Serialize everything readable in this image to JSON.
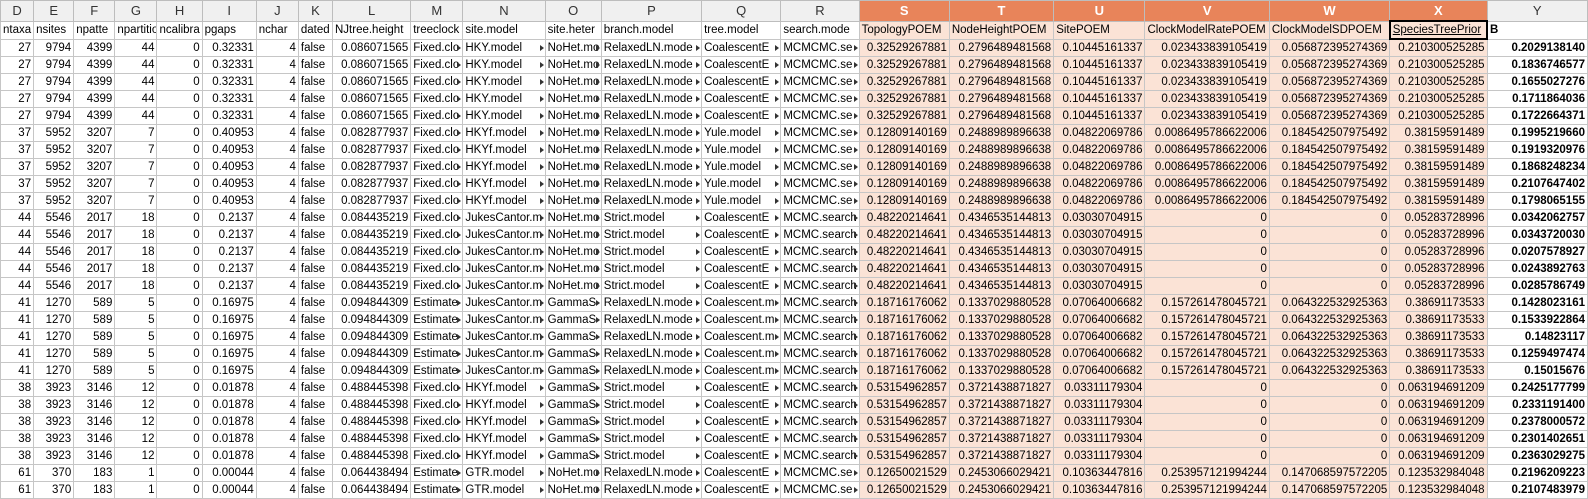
{
  "column_letters": [
    "D",
    "E",
    "F",
    "G",
    "H",
    "I",
    "J",
    "K",
    "L",
    "M",
    "N",
    "O",
    "P",
    "Q",
    "R",
    "S",
    "T",
    "U",
    "V",
    "W",
    "X",
    "Y"
  ],
  "selected_columns": [
    "S",
    "T",
    "U",
    "V",
    "W",
    "X"
  ],
  "header_row": [
    "ntaxa",
    "nsites",
    "npatte",
    "npartitio",
    "ncalibra",
    "pgaps",
    "nchar",
    "dated",
    "NJtree.height",
    "treeclock",
    "site.model",
    "site.heter",
    "branch.model",
    "tree.model",
    "search.mode",
    "TopologyPOEM",
    "NodeHeightPOEM",
    "SitePOEM",
    "ClockModelRatePOEM",
    "ClockModelSDPOEM",
    "SpeciesTreePrior",
    "B"
  ],
  "rows": [
    [
      "27",
      "9794",
      "4399",
      "44",
      "0",
      "0.32331",
      "4",
      "false",
      "0.086071565",
      "Fixed.clo",
      "HKY.model",
      "NoHet.mo",
      "RelaxedLN.mode",
      "CoalescentE",
      "MCMCMC.se",
      "0.32529267881",
      "0.2796489481568",
      "0.10445161337",
      "0.023433839105419",
      "0.056872395274369",
      "0.210300525285",
      "0.2029138140"
    ],
    [
      "27",
      "9794",
      "4399",
      "44",
      "0",
      "0.32331",
      "4",
      "false",
      "0.086071565",
      "Fixed.clo",
      "HKY.model",
      "NoHet.mo",
      "RelaxedLN.mode",
      "CoalescentE",
      "MCMCMC.se",
      "0.32529267881",
      "0.2796489481568",
      "0.10445161337",
      "0.023433839105419",
      "0.056872395274369",
      "0.210300525285",
      "0.1836746577"
    ],
    [
      "27",
      "9794",
      "4399",
      "44",
      "0",
      "0.32331",
      "4",
      "false",
      "0.086071565",
      "Fixed.clo",
      "HKY.model",
      "NoHet.mo",
      "RelaxedLN.mode",
      "CoalescentE",
      "MCMCMC.se",
      "0.32529267881",
      "0.2796489481568",
      "0.10445161337",
      "0.023433839105419",
      "0.056872395274369",
      "0.210300525285",
      "0.1655027276"
    ],
    [
      "27",
      "9794",
      "4399",
      "44",
      "0",
      "0.32331",
      "4",
      "false",
      "0.086071565",
      "Fixed.clo",
      "HKY.model",
      "NoHet.mo",
      "RelaxedLN.mode",
      "CoalescentE",
      "MCMCMC.se",
      "0.32529267881",
      "0.2796489481568",
      "0.10445161337",
      "0.023433839105419",
      "0.056872395274369",
      "0.210300525285",
      "0.1711864036"
    ],
    [
      "27",
      "9794",
      "4399",
      "44",
      "0",
      "0.32331",
      "4",
      "false",
      "0.086071565",
      "Fixed.clo",
      "HKY.model",
      "NoHet.mo",
      "RelaxedLN.mode",
      "CoalescentE",
      "MCMCMC.se",
      "0.32529267881",
      "0.2796489481568",
      "0.10445161337",
      "0.023433839105419",
      "0.056872395274369",
      "0.210300525285",
      "0.1722664371"
    ],
    [
      "37",
      "5952",
      "3207",
      "7",
      "0",
      "0.40953",
      "4",
      "false",
      "0.082877937",
      "Fixed.clo",
      "HKYf.model",
      "NoHet.mo",
      "RelaxedLN.mode",
      "Yule.model",
      "MCMCMC.se",
      "0.12809140169",
      "0.2488989896638",
      "0.04822069786",
      "0.0086495786622006",
      "0.184542507975492",
      "0.38159591489",
      "0.1995219660"
    ],
    [
      "37",
      "5952",
      "3207",
      "7",
      "0",
      "0.40953",
      "4",
      "false",
      "0.082877937",
      "Fixed.clo",
      "HKYf.model",
      "NoHet.mo",
      "RelaxedLN.mode",
      "Yule.model",
      "MCMCMC.se",
      "0.12809140169",
      "0.2488989896638",
      "0.04822069786",
      "0.0086495786622006",
      "0.184542507975492",
      "0.38159591489",
      "0.1919320976"
    ],
    [
      "37",
      "5952",
      "3207",
      "7",
      "0",
      "0.40953",
      "4",
      "false",
      "0.082877937",
      "Fixed.clo",
      "HKYf.model",
      "NoHet.mo",
      "RelaxedLN.mode",
      "Yule.model",
      "MCMCMC.se",
      "0.12809140169",
      "0.2488989896638",
      "0.04822069786",
      "0.0086495786622006",
      "0.184542507975492",
      "0.38159591489",
      "0.1868248234"
    ],
    [
      "37",
      "5952",
      "3207",
      "7",
      "0",
      "0.40953",
      "4",
      "false",
      "0.082877937",
      "Fixed.clo",
      "HKYf.model",
      "NoHet.mo",
      "RelaxedLN.mode",
      "Yule.model",
      "MCMCMC.se",
      "0.12809140169",
      "0.2488989896638",
      "0.04822069786",
      "0.0086495786622006",
      "0.184542507975492",
      "0.38159591489",
      "0.2107647402"
    ],
    [
      "37",
      "5952",
      "3207",
      "7",
      "0",
      "0.40953",
      "4",
      "false",
      "0.082877937",
      "Fixed.clo",
      "HKYf.model",
      "NoHet.mo",
      "RelaxedLN.mode",
      "Yule.model",
      "MCMCMC.se",
      "0.12809140169",
      "0.2488989896638",
      "0.04822069786",
      "0.0086495786622006",
      "0.184542507975492",
      "0.38159591489",
      "0.1798065155"
    ],
    [
      "44",
      "5546",
      "2017",
      "18",
      "0",
      "0.2137",
      "4",
      "false",
      "0.084435219",
      "Fixed.clo",
      "JukesCantor.m",
      "NoHet.mo",
      "Strict.model",
      "CoalescentE",
      "MCMC.search",
      "0.48220214641",
      "0.4346535144813",
      "0.03030704915",
      "0",
      "0",
      "0.05283728996",
      "0.0342062757"
    ],
    [
      "44",
      "5546",
      "2017",
      "18",
      "0",
      "0.2137",
      "4",
      "false",
      "0.084435219",
      "Fixed.clo",
      "JukesCantor.m",
      "NoHet.mo",
      "Strict.model",
      "CoalescentE",
      "MCMC.search",
      "0.48220214641",
      "0.4346535144813",
      "0.03030704915",
      "0",
      "0",
      "0.05283728996",
      "0.0343720030"
    ],
    [
      "44",
      "5546",
      "2017",
      "18",
      "0",
      "0.2137",
      "4",
      "false",
      "0.084435219",
      "Fixed.clo",
      "JukesCantor.m",
      "NoHet.mo",
      "Strict.model",
      "CoalescentE",
      "MCMC.search",
      "0.48220214641",
      "0.4346535144813",
      "0.03030704915",
      "0",
      "0",
      "0.05283728996",
      "0.0207578927"
    ],
    [
      "44",
      "5546",
      "2017",
      "18",
      "0",
      "0.2137",
      "4",
      "false",
      "0.084435219",
      "Fixed.clo",
      "JukesCantor.m",
      "NoHet.mo",
      "Strict.model",
      "CoalescentE",
      "MCMC.search",
      "0.48220214641",
      "0.4346535144813",
      "0.03030704915",
      "0",
      "0",
      "0.05283728996",
      "0.0243892763"
    ],
    [
      "44",
      "5546",
      "2017",
      "18",
      "0",
      "0.2137",
      "4",
      "false",
      "0.084435219",
      "Fixed.clo",
      "JukesCantor.m",
      "NoHet.mo",
      "Strict.model",
      "CoalescentE",
      "MCMC.search",
      "0.48220214641",
      "0.4346535144813",
      "0.03030704915",
      "0",
      "0",
      "0.05283728996",
      "0.0285786749"
    ],
    [
      "41",
      "1270",
      "589",
      "5",
      "0",
      "0.16975",
      "4",
      "false",
      "0.094844309",
      "Estimate",
      "JukesCantor.m",
      "GammaS",
      "RelaxedLN.mode",
      "Coalescent.m",
      "MCMC.search",
      "0.18716176062",
      "0.1337029880528",
      "0.07064006682",
      "0.157261478045721",
      "0.064322532925363",
      "0.38691173533",
      "0.1428023161"
    ],
    [
      "41",
      "1270",
      "589",
      "5",
      "0",
      "0.16975",
      "4",
      "false",
      "0.094844309",
      "Estimate",
      "JukesCantor.m",
      "GammaS",
      "RelaxedLN.mode",
      "Coalescent.m",
      "MCMC.search",
      "0.18716176062",
      "0.1337029880528",
      "0.07064006682",
      "0.157261478045721",
      "0.064322532925363",
      "0.38691173533",
      "0.1533922864"
    ],
    [
      "41",
      "1270",
      "589",
      "5",
      "0",
      "0.16975",
      "4",
      "false",
      "0.094844309",
      "Estimate",
      "JukesCantor.m",
      "GammaS",
      "RelaxedLN.mode",
      "Coalescent.m",
      "MCMC.search",
      "0.18716176062",
      "0.1337029880528",
      "0.07064006682",
      "0.157261478045721",
      "0.064322532925363",
      "0.38691173533",
      "0.14823117"
    ],
    [
      "41",
      "1270",
      "589",
      "5",
      "0",
      "0.16975",
      "4",
      "false",
      "0.094844309",
      "Estimate",
      "JukesCantor.m",
      "GammaS",
      "RelaxedLN.mode",
      "Coalescent.m",
      "MCMC.search",
      "0.18716176062",
      "0.1337029880528",
      "0.07064006682",
      "0.157261478045721",
      "0.064322532925363",
      "0.38691173533",
      "0.1259497474"
    ],
    [
      "41",
      "1270",
      "589",
      "5",
      "0",
      "0.16975",
      "4",
      "false",
      "0.094844309",
      "Estimate",
      "JukesCantor.m",
      "GammaS",
      "RelaxedLN.mode",
      "Coalescent.m",
      "MCMC.search",
      "0.18716176062",
      "0.1337029880528",
      "0.07064006682",
      "0.157261478045721",
      "0.064322532925363",
      "0.38691173533",
      "0.15015676"
    ],
    [
      "38",
      "3923",
      "3146",
      "12",
      "0",
      "0.01878",
      "4",
      "false",
      "0.488445398",
      "Fixed.clo",
      "HKYf.model",
      "GammaS",
      "Strict.model",
      "CoalescentE",
      "MCMC.search",
      "0.53154962857",
      "0.3721438871827",
      "0.03311179304",
      "0",
      "0",
      "0.063194691209",
      "0.2425177799"
    ],
    [
      "38",
      "3923",
      "3146",
      "12",
      "0",
      "0.01878",
      "4",
      "false",
      "0.488445398",
      "Fixed.clo",
      "HKYf.model",
      "GammaS",
      "Strict.model",
      "CoalescentE",
      "MCMC.search",
      "0.53154962857",
      "0.3721438871827",
      "0.03311179304",
      "0",
      "0",
      "0.063194691209",
      "0.2331191400"
    ],
    [
      "38",
      "3923",
      "3146",
      "12",
      "0",
      "0.01878",
      "4",
      "false",
      "0.488445398",
      "Fixed.clo",
      "HKYf.model",
      "GammaS",
      "Strict.model",
      "CoalescentE",
      "MCMC.search",
      "0.53154962857",
      "0.3721438871827",
      "0.03311179304",
      "0",
      "0",
      "0.063194691209",
      "0.2378000572"
    ],
    [
      "38",
      "3923",
      "3146",
      "12",
      "0",
      "0.01878",
      "4",
      "false",
      "0.488445398",
      "Fixed.clo",
      "HKYf.model",
      "GammaS",
      "Strict.model",
      "CoalescentE",
      "MCMC.search",
      "0.53154962857",
      "0.3721438871827",
      "0.03311179304",
      "0",
      "0",
      "0.063194691209",
      "0.2301402651"
    ],
    [
      "38",
      "3923",
      "3146",
      "12",
      "0",
      "0.01878",
      "4",
      "false",
      "0.488445398",
      "Fixed.clo",
      "HKYf.model",
      "GammaS",
      "Strict.model",
      "CoalescentE",
      "MCMC.search",
      "0.53154962857",
      "0.3721438871827",
      "0.03311179304",
      "0",
      "0",
      "0.063194691209",
      "0.2363029275"
    ],
    [
      "61",
      "370",
      "183",
      "1",
      "0",
      "0.00044",
      "4",
      "false",
      "0.064438494",
      "Estimate",
      "GTR.model",
      "NoHet.mo",
      "RelaxedLN.mode",
      "CoalescentE",
      "MCMCMC.se",
      "0.12650021529",
      "0.2453066029421",
      "0.10363447816",
      "0.253957121994244",
      "0.147068597572205",
      "0.123532984048",
      "0.2196209223"
    ],
    [
      "61",
      "370",
      "183",
      "1",
      "0",
      "0.00044",
      "4",
      "false",
      "0.064438494",
      "Estimate",
      "GTR.model",
      "NoHet.mo",
      "RelaxedLN.mode",
      "CoalescentE",
      "MCMCMC.se",
      "0.12650021529",
      "0.2453066029421",
      "0.10363447816",
      "0.253957121994244",
      "0.147068597572205",
      "0.123532984048",
      "0.2107483979"
    ]
  ]
}
